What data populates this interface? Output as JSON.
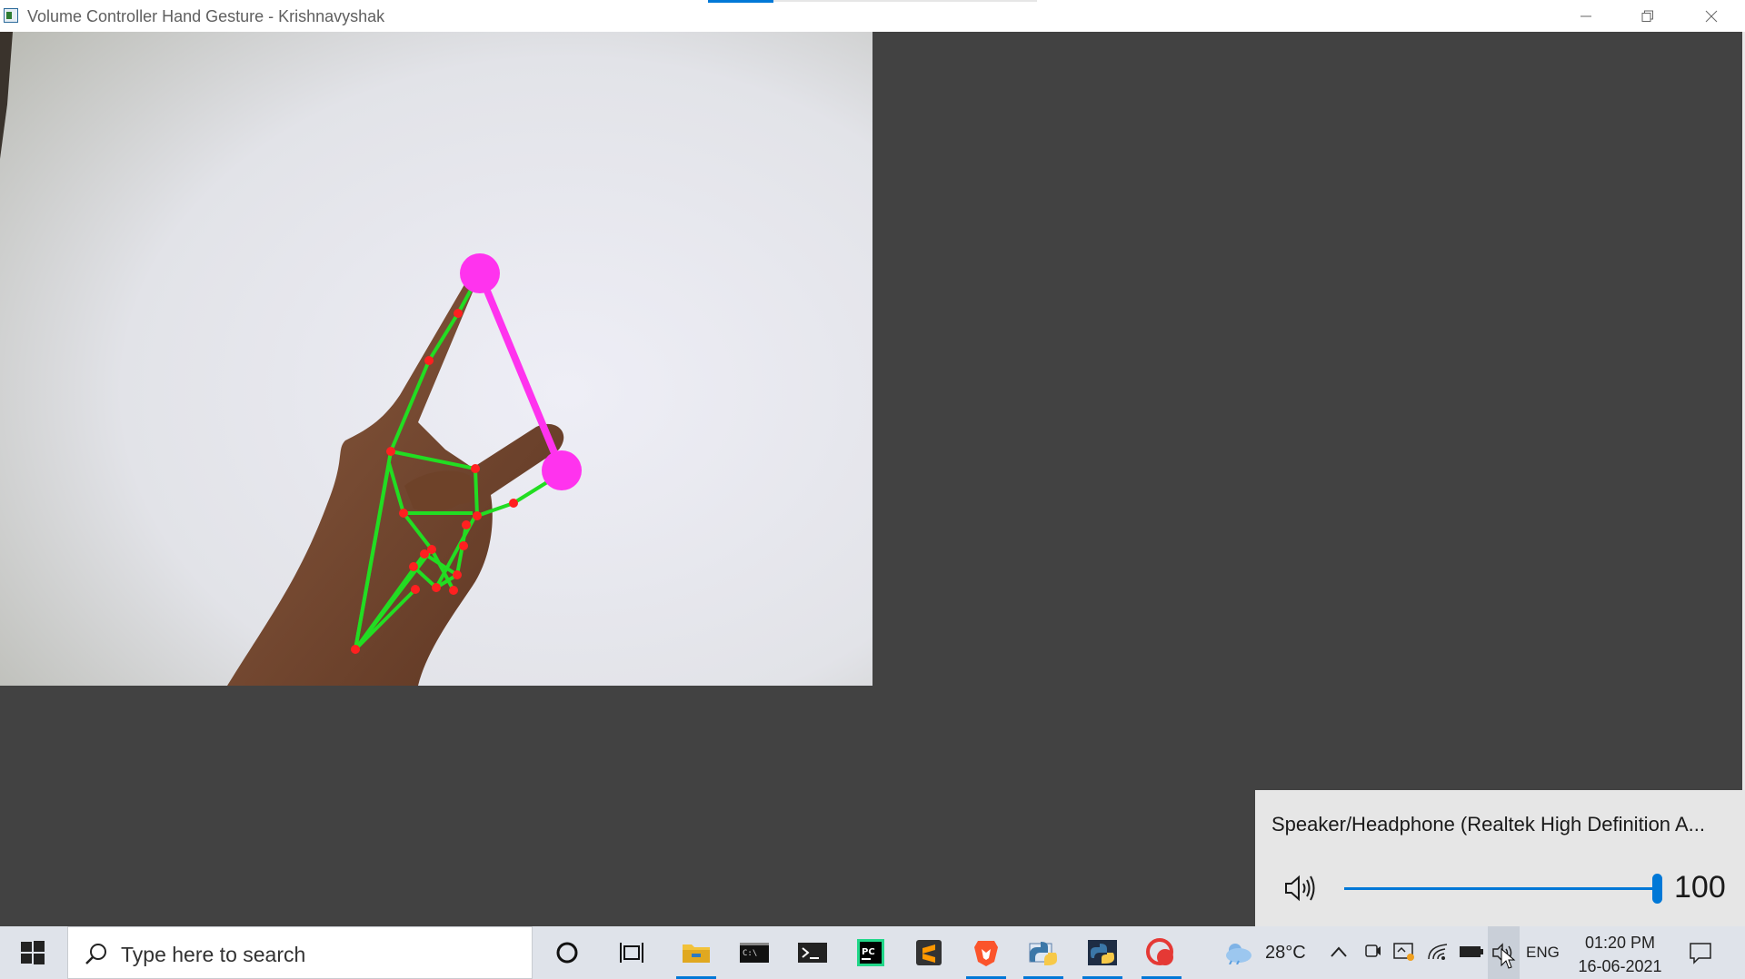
{
  "window": {
    "title": "Volume Controller Hand Gesture - Krishnavyshak",
    "controls": {
      "minimize": "—",
      "maximize": "⧉",
      "close": "✕"
    }
  },
  "camera": {
    "description_icon": "camera-feed",
    "landmark_color": "#ff2020",
    "skeleton_color": "#22dd22",
    "gesture_line_color": "#ff33ee"
  },
  "volume_flyout": {
    "device_name": "Speaker/Headphone (Realtek High Definition A...",
    "volume_level": "100",
    "volume_fraction": 1.0,
    "icon": "speaker-icon"
  },
  "taskbar": {
    "search_placeholder": "Type here to search",
    "apps": [
      {
        "name": "cortana-icon"
      },
      {
        "name": "task-view-icon"
      },
      {
        "name": "file-explorer-icon",
        "active": true
      },
      {
        "name": "command-prompt-icon"
      },
      {
        "name": "terminal-icon"
      },
      {
        "name": "pycharm-icon"
      },
      {
        "name": "sublime-text-icon"
      },
      {
        "name": "brave-icon",
        "active": true
      },
      {
        "name": "python-idle-icon",
        "active": true
      },
      {
        "name": "python-app-icon",
        "active": true
      },
      {
        "name": "record-icon",
        "active": true
      }
    ],
    "tray": {
      "weather_temp": "28°C",
      "language": "ENG",
      "time": "01:20 PM",
      "date": "16-06-2021"
    }
  }
}
